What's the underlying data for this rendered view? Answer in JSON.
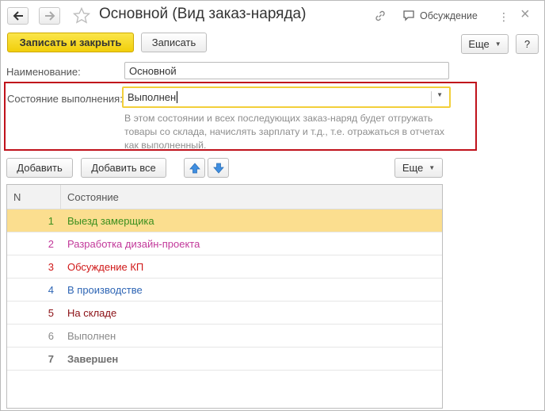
{
  "window": {
    "title": "Основной (Вид заказ-наряда)",
    "discuss_label": "Обсуждение",
    "more_dots": "⋮",
    "close": "×"
  },
  "toolbar": {
    "save_close": "Записать и закрыть",
    "save": "Записать",
    "more": "Еще",
    "help": "?"
  },
  "form": {
    "name_label": "Наименование:",
    "name_value": "Основной",
    "state_label": "Состояние выполнения:",
    "state_value": "Выполнен",
    "hint": "В этом состоянии и всех последующих заказ-наряд будет отгружать товары со склада, начислять зарплату и т.д., т.е. отражаться в отчетах как выполненный."
  },
  "list_toolbar": {
    "add": "Добавить",
    "add_all": "Добавить все",
    "more": "Еще"
  },
  "table": {
    "headers": [
      "N",
      "Состояние"
    ],
    "rows": [
      {
        "n": "1",
        "state": "Выезд замерщика",
        "color": "#3b8f1e",
        "bold": false,
        "selected": true
      },
      {
        "n": "2",
        "state": "Разработка дизайн-проекта",
        "color": "#c2399a",
        "bold": false,
        "selected": false
      },
      {
        "n": "3",
        "state": "Обсуждение КП",
        "color": "#d01818",
        "bold": false,
        "selected": false
      },
      {
        "n": "4",
        "state": "В производстве",
        "color": "#2f66b5",
        "bold": false,
        "selected": false
      },
      {
        "n": "5",
        "state": "На складе",
        "color": "#8b0f14",
        "bold": false,
        "selected": false
      },
      {
        "n": "6",
        "state": "Выполнен",
        "color": "#8a8a8a",
        "bold": false,
        "selected": false
      },
      {
        "n": "7",
        "state": "Завершен",
        "color": "#707070",
        "bold": true,
        "selected": false
      }
    ]
  },
  "colors": {
    "accent_yellow": "#f5d422",
    "highlight_red": "#c0121b",
    "selected_row": "#fbde8f"
  }
}
